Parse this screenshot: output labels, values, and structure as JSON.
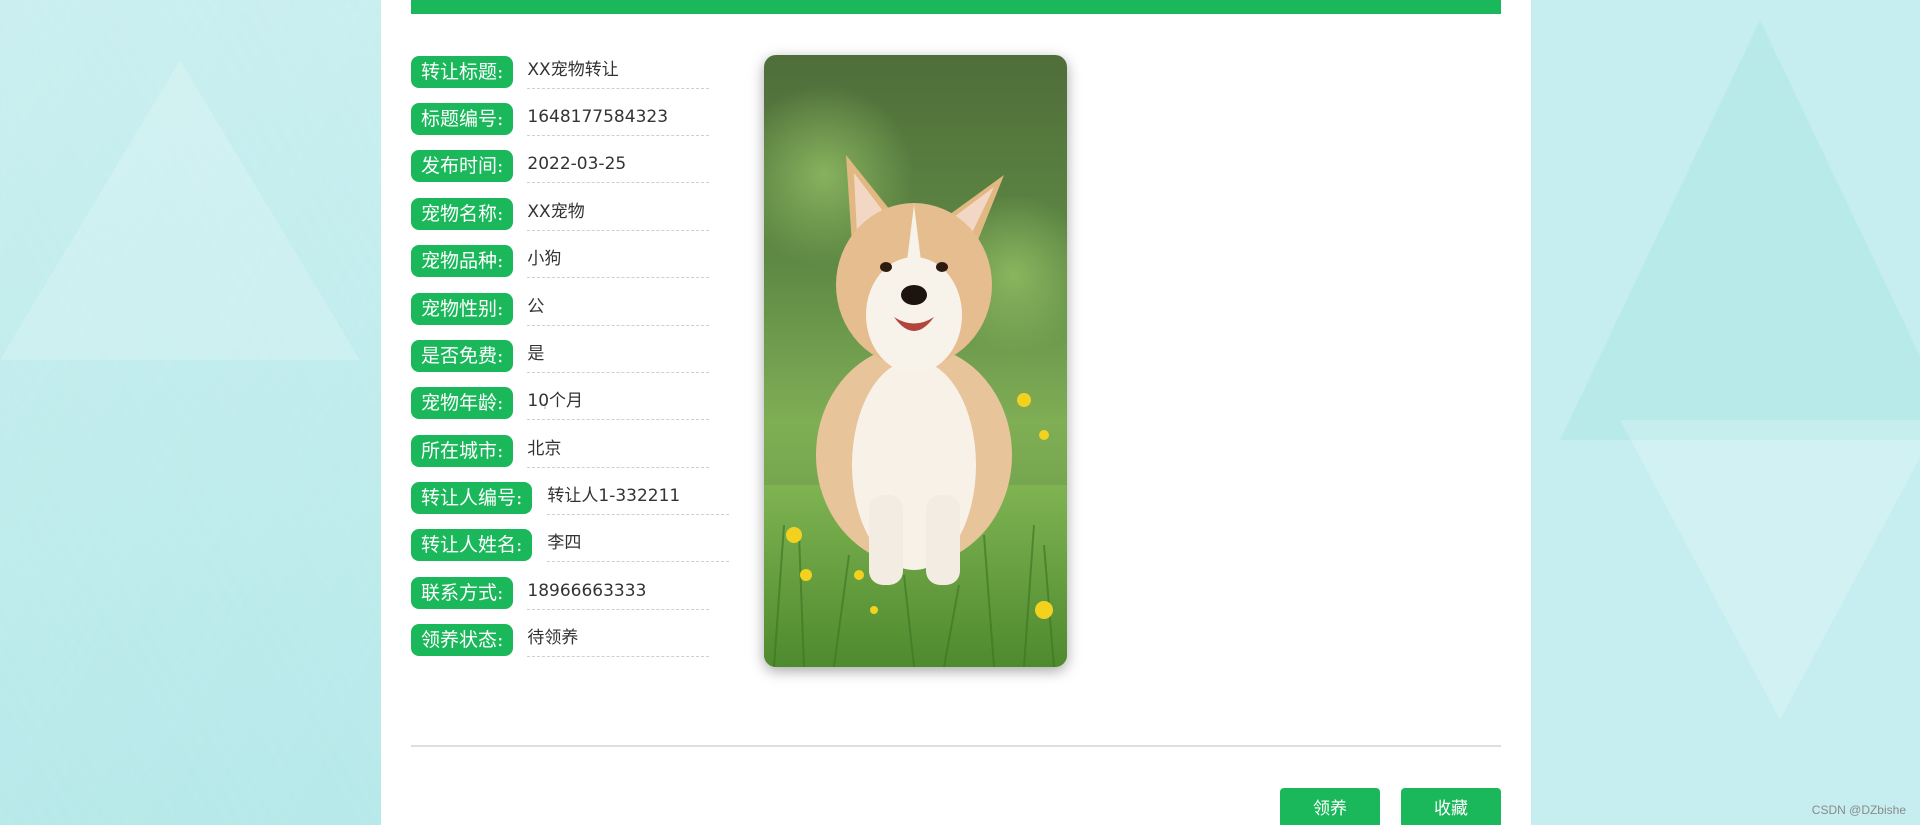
{
  "details": {
    "fields": [
      {
        "label": "转让标题:",
        "value": "XX宠物转让"
      },
      {
        "label": "标题编号:",
        "value": "1648177584323"
      },
      {
        "label": "发布时间:",
        "value": "2022-03-25"
      },
      {
        "label": "宠物名称:",
        "value": "XX宠物"
      },
      {
        "label": "宠物品种:",
        "value": "小狗"
      },
      {
        "label": "宠物性别:",
        "value": "公"
      },
      {
        "label": "是否免费:",
        "value": "是"
      },
      {
        "label": "宠物年龄:",
        "value": "10个月"
      },
      {
        "label": "所在城市:",
        "value": "北京"
      },
      {
        "label": "转让人编号:",
        "value": "转让人1-332211"
      },
      {
        "label": "转让人姓名:",
        "value": "李四"
      },
      {
        "label": "联系方式:",
        "value": "18966663333"
      },
      {
        "label": "领养状态:",
        "value": "待领养"
      }
    ]
  },
  "actions": {
    "adopt_label": "领养",
    "favorite_label": "收藏"
  },
  "watermark": "CSDN @DZbishe",
  "colors": {
    "accent": "#1bb85b",
    "background": "#c6eef0",
    "panel": "#ffffff"
  }
}
